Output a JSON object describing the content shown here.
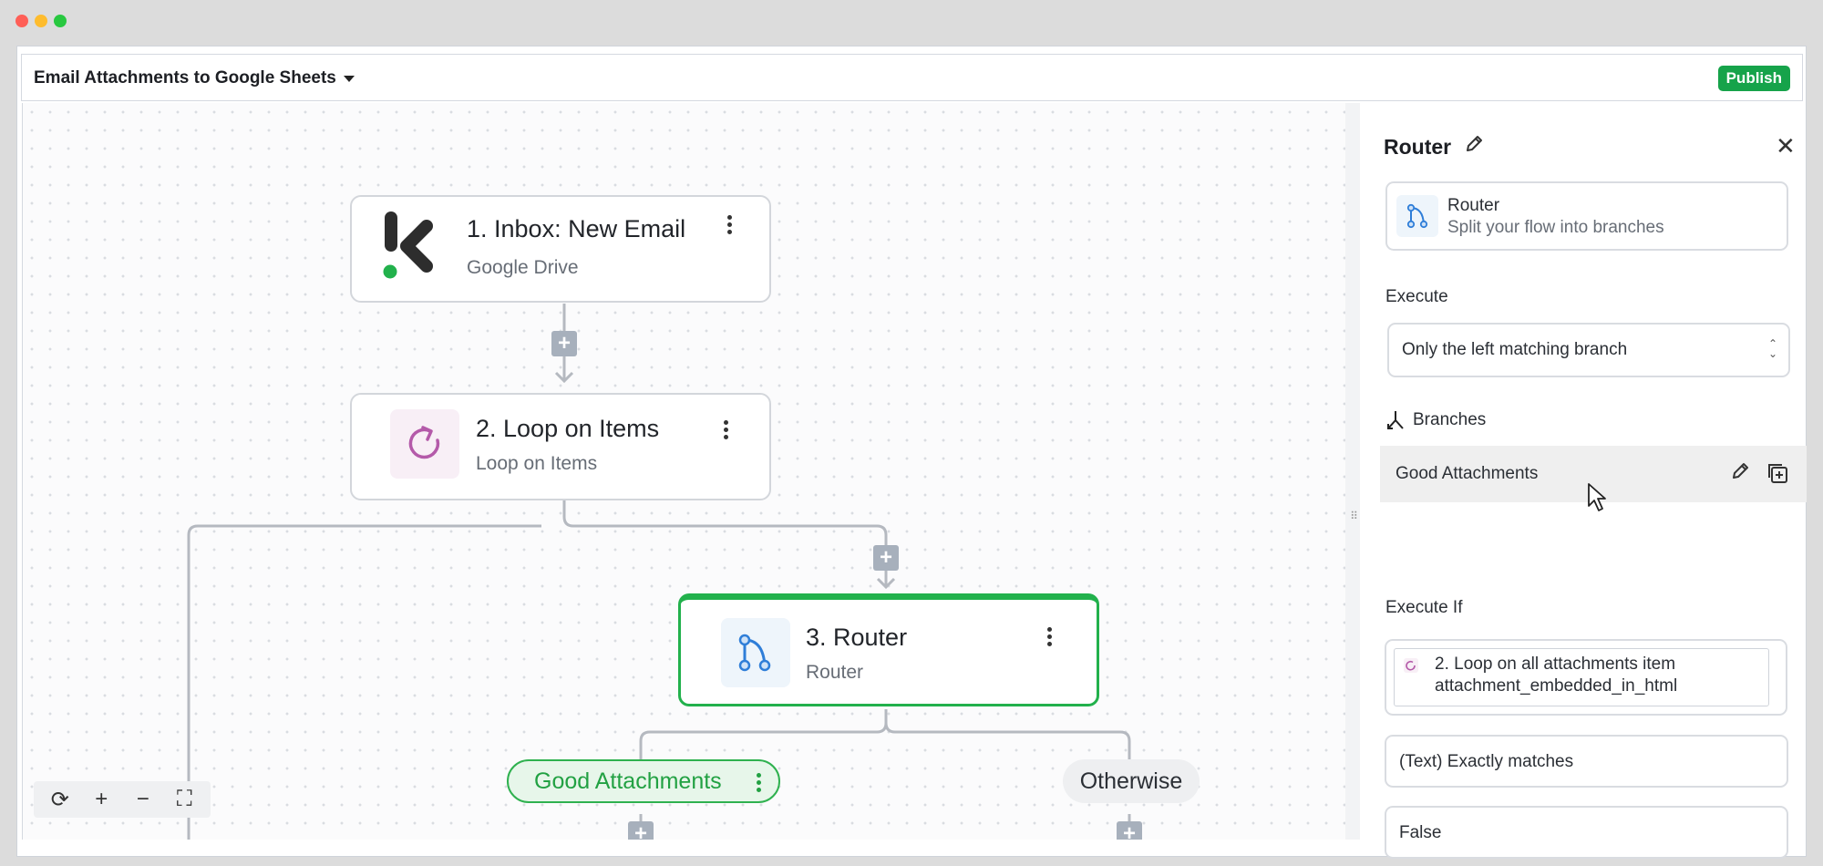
{
  "window": {
    "traffic_lights": [
      "#ff5f57",
      "#febc2e",
      "#28c840"
    ]
  },
  "header": {
    "flow_title": "Email Attachments to Google Sheets",
    "publish_label": "Publish"
  },
  "nodes": [
    {
      "title": "1. Inbox: New Email",
      "subtitle": "Google Drive"
    },
    {
      "title": "2. Loop on Items",
      "subtitle": "Loop on Items"
    },
    {
      "title": "3. Router",
      "subtitle": "Router"
    }
  ],
  "branches": {
    "good": "Good Attachments",
    "otherwise": "Otherwise"
  },
  "zoom_controls": [
    "refresh-icon",
    "zoom-in-icon",
    "zoom-out-icon",
    "fit-view-icon"
  ],
  "panel": {
    "title": "Router",
    "piece_name": "Router",
    "piece_description": "Split your flow into branches",
    "execute_label": "Execute",
    "execute_value": "Only the left matching branch",
    "branches_label": "Branches",
    "selected_branch": "Good Attachments",
    "execute_if_label": "Execute If",
    "condition_first_value_line1": "2. Loop on all attachments item",
    "condition_first_value_line2": "attachment_embedded_in_html",
    "condition_operator": "(Text) Exactly matches",
    "condition_second_value": "False"
  },
  "colors": {
    "accent_green": "#16a34a",
    "router_border": "#22b14c",
    "loop_purple": "#b45aa9",
    "router_blue": "#2f7ed8"
  }
}
